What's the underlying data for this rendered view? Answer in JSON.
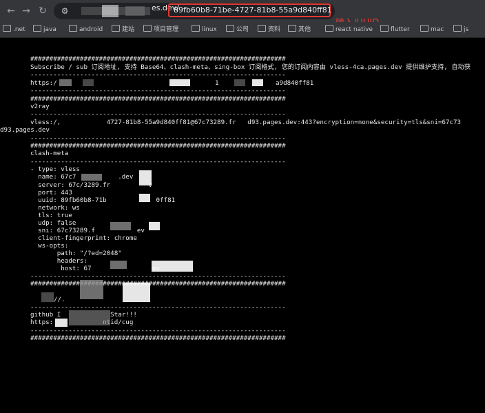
{
  "browser": {
    "url_prefix": "es.dev/",
    "url_uuid": "89fb60b8-71be-4727-81b8-55a9d840ff81",
    "annotation": "输入/UUID",
    "bookmarks": [
      ".net",
      "java",
      "android",
      "建站",
      "项目管理",
      "linux",
      "公司",
      "资料",
      "其他",
      "react native",
      "flutter",
      "mac",
      "js"
    ]
  },
  "terminal": {
    "sep_hash": "###################################################################",
    "sep_dash": "-------------------------------------------------------------------",
    "intro": "Subscribe / sub 订阅地址, 支持 Base64、clash-meta、sing-box 订阅格式, 您的订阅内容由 vless-4ca.pages.dev 提供维护支持, 自动获",
    "sub_url_start": "https:/",
    "sub_url_mid": "1",
    "sub_url_end": "a9d840ff81",
    "v2ray_title": "v2ray",
    "vless_line": "vless:/,            4727-81b8-55a9d840ff81@67c73289.fr   d93.pages.dev:443?encryption=none&security=tls&sni=67c73",
    "vless_wrap": "d93.pages.dev",
    "clash_title": "clash-meta",
    "clash_lines": [
      "- type: vless",
      "  name: 67c7           .dev",
      "  server: 67c/3289.fr          v",
      "  port: 443",
      "  uuid: 89fb60b8-71b             0ff81",
      "  network: ws",
      "  tls: true",
      "  udp: false",
      "  sni: 67c73289.f           ev",
      "  client-fingerprint: chrome",
      "  ws-opts:",
      "       path: \"/?ed=2048\"",
      "       headers:",
      "        host: 67                ev"
    ],
    "footer_line1": "//.",
    "footer_github": "github I             Star!!!",
    "footer_https": "https:             ntid/cug"
  }
}
